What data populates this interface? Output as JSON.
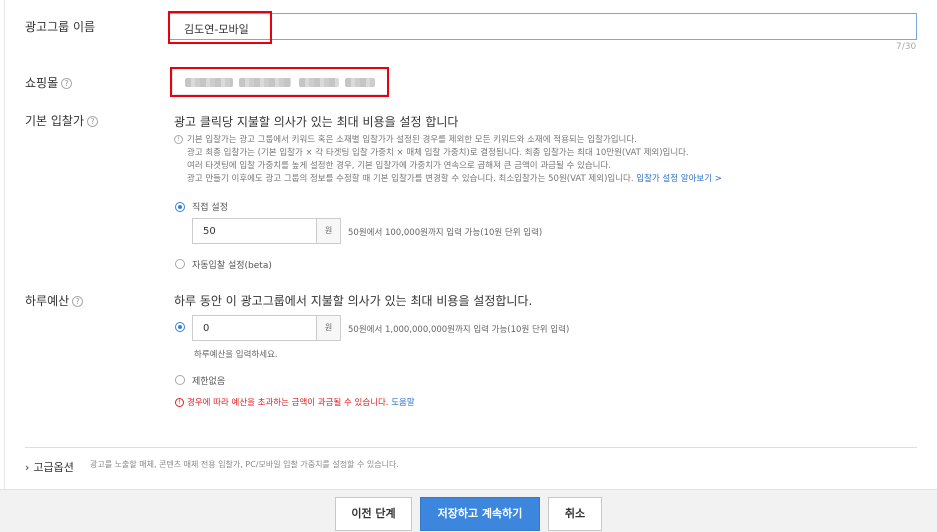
{
  "ad_group_name": {
    "label": "광고그룹 이름",
    "value": "김도연-모바일",
    "counter": "7/30"
  },
  "shopping_mall": {
    "label": "쇼핑몰"
  },
  "default_bid": {
    "label": "기본 입찰가",
    "headline": "광고 클릭당 지불할 의사가 있는 최대 비용을 설정 합니다",
    "info_lines": [
      "기본 입찰가는 광고 그룹에서 키워드 혹은 소재별 입찰가가 설정된 경우를 제외한 모든 키워드와 소재에 적용되는 입찰가입니다.",
      "광고 최종 입찰가는 (기본 입찰가 × 각 타겟팅 입찰 가중치 × 매체 입찰 가중치)로 결정됩니다. 최종 입찰가는 최대 10만원(VAT 제외)입니다.",
      "여러 타겟팅에 입찰 가중치를 높게 설정한 경우, 기본 입찰가에 가중치가 연속으로 곱해져 큰 금액이 과금될 수 있습니다.",
      "광고 만들기 이후에도 광고 그룹의 정보를 수정할 때 기본 입찰가를 변경할 수 있습니다. 최소입찰가는 50원(VAT 제외)입니다."
    ],
    "info_link": "입찰가 설정 알아보기 >",
    "option_manual": "직접 설정",
    "manual_value": "50",
    "unit": "원",
    "manual_hint": "50원에서 100,000원까지 입력 가능(10원 단위 입력)",
    "option_auto": "자동입찰 설정(beta)"
  },
  "daily_budget": {
    "label": "하루예산",
    "headline": "하루 동안 이 광고그룹에서 지불할 의사가 있는 최대 비용을 설정합니다.",
    "value": "0",
    "unit": "원",
    "hint": "50원에서 1,000,000,000원까지 입력 가능(10원 단위 입력)",
    "sub_hint": "하루예산을 입력하세요.",
    "option_unlimited": "제한없음",
    "warning": "경우에 따라 예산을 초과하는 금액이 과금될 수 있습니다.",
    "warning_link": "도움말"
  },
  "advanced": {
    "label": "고급옵션",
    "description": "광고를 노출할 매체, 콘텐츠 매체 전용 입찰가, PC/모바일 입찰 가중치를 설정할 수 있습니다."
  },
  "buttons": {
    "prev": "이전 단계",
    "save": "저장하고 계속하기",
    "cancel": "취소"
  },
  "icons": {
    "help": "?",
    "info": "!",
    "chevron": "›"
  },
  "colors": {
    "accent": "#3d86dd",
    "highlight": "#e8000c",
    "warning": "#e02020"
  }
}
